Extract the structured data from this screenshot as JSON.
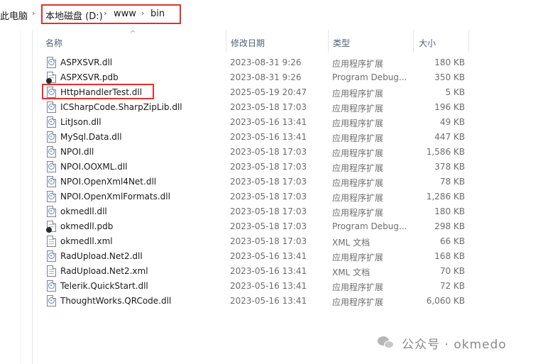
{
  "address": {
    "root": "此电脑",
    "crumbs": [
      "本地磁盘 (D:)",
      "www",
      "bin"
    ],
    "separator": "›"
  },
  "columns": {
    "name": "名称",
    "modified": "修改日期",
    "type": "类型",
    "size": "大小"
  },
  "files": [
    {
      "name": "ASPXSVR.dll",
      "modified": "2023-08-31 9:26",
      "type": "应用程序扩展",
      "size": "180 KB",
      "icon": "dll-icon"
    },
    {
      "name": "ASPXSVR.pdb",
      "modified": "2023-08-31 9:26",
      "type": "Program Debug...",
      "size": "350 KB",
      "icon": "pdb-icon"
    },
    {
      "name": "HttpHandlerTest.dll",
      "modified": "2025-05-19 20:47",
      "type": "应用程序扩展",
      "size": "5 KB",
      "icon": "dll-icon"
    },
    {
      "name": "ICSharpCode.SharpZipLib.dll",
      "modified": "2023-05-18 17:03",
      "type": "应用程序扩展",
      "size": "196 KB",
      "icon": "dll-icon"
    },
    {
      "name": "LitJson.dll",
      "modified": "2023-05-16 13:41",
      "type": "应用程序扩展",
      "size": "49 KB",
      "icon": "dll-icon"
    },
    {
      "name": "MySql.Data.dll",
      "modified": "2023-05-16 13:41",
      "type": "应用程序扩展",
      "size": "447 KB",
      "icon": "dll-icon"
    },
    {
      "name": "NPOI.dll",
      "modified": "2023-05-18 17:03",
      "type": "应用程序扩展",
      "size": "1,586 KB",
      "icon": "dll-icon"
    },
    {
      "name": "NPOI.OOXML.dll",
      "modified": "2023-05-18 17:03",
      "type": "应用程序扩展",
      "size": "378 KB",
      "icon": "dll-icon"
    },
    {
      "name": "NPOI.OpenXml4Net.dll",
      "modified": "2023-05-18 17:03",
      "type": "应用程序扩展",
      "size": "78 KB",
      "icon": "dll-icon"
    },
    {
      "name": "NPOI.OpenXmlFormats.dll",
      "modified": "2023-05-18 17:03",
      "type": "应用程序扩展",
      "size": "1,286 KB",
      "icon": "dll-icon"
    },
    {
      "name": "okmedll.dll",
      "modified": "2023-05-18 17:03",
      "type": "应用程序扩展",
      "size": "180 KB",
      "icon": "dll-icon"
    },
    {
      "name": "okmedll.pdb",
      "modified": "2023-05-18 17:03",
      "type": "Program Debug...",
      "size": "298 KB",
      "icon": "pdb-icon"
    },
    {
      "name": "okmedll.xml",
      "modified": "2023-05-18 17:03",
      "type": "XML 文档",
      "size": "66 KB",
      "icon": "xml-icon"
    },
    {
      "name": "RadUpload.Net2.dll",
      "modified": "2023-05-16 13:41",
      "type": "应用程序扩展",
      "size": "168 KB",
      "icon": "dll-icon"
    },
    {
      "name": "RadUpload.Net2.xml",
      "modified": "2023-05-16 13:41",
      "type": "XML 文档",
      "size": "70 KB",
      "icon": "xml-icon"
    },
    {
      "name": "Telerik.QuickStart.dll",
      "modified": "2023-05-16 13:41",
      "type": "应用程序扩展",
      "size": "72 KB",
      "icon": "dll-icon"
    },
    {
      "name": "ThoughtWorks.QRCode.dll",
      "modified": "2023-05-16 13:41",
      "type": "应用程序扩展",
      "size": "6,060 KB",
      "icon": "dll-icon"
    }
  ],
  "watermark": {
    "text": "公众号 · okmedo",
    "icon": "wechat-icon"
  },
  "colors": {
    "highlight_border": "#e0322b",
    "header_text": "#4c607a"
  }
}
